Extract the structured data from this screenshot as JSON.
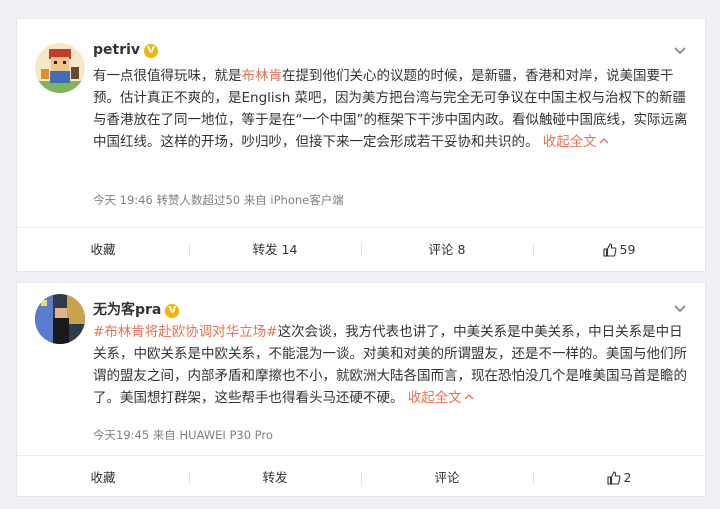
{
  "posts": [
    {
      "username": "petriv",
      "text_segments": [
        "有一点很值得玩味，就是",
        "布林肯",
        "在提到他们关心的议题的时候，是新疆，香港和对岸，说美国要干预。估计真正不爽的，是English 菜吧，因为美方把台湾与完全无可争议在中国主权与治权下的新疆与香港放在了同一地位，等于是在“一个中国”的框架下干涉中国内政。看似触碰中国底线，实际远离中国红线。这样的开场，吵归吵，但接下来一定会形成若干妥协和共识的。",
        "收起全文"
      ],
      "meta": "今天 19:46 转赞人数超过50   来自 iPhone客户端",
      "actions": {
        "collect": "收藏",
        "repost": "转发 14",
        "comment": "评论 8",
        "like": "59"
      }
    },
    {
      "username": "无为客pra",
      "text_segments": [
        "#布林肯将赴欧协调对华立场#",
        "这次会谈，我方代表也讲了，中美关系是中美关系，中日关系是中日关系，中欧关系是中欧关系，不能混为一谈。对美和对美的所谓盟友，还是不一样的。美国与他们所谓的盟友之间，内部矛盾和摩擦也不小，就欧洲大陆各国而言，现在恐怕没几个是唯美国马首是瞻的了。美国想打群架，这些帮手也得看头马还硬不硬。",
        "收起全文"
      ],
      "meta": "今天19:45 来自 HUAWEI P30 Pro",
      "actions": {
        "collect": "收藏",
        "repost": "转发",
        "comment": "评论",
        "like": "2"
      }
    }
  ],
  "icons": {
    "verified": "verified-v-icon",
    "more": "chevron-down-icon",
    "like": "thumbs-up-icon",
    "collapse": "chevron-up-icon"
  },
  "colors": {
    "accent": "#eb7350",
    "badge": "#f4b400"
  }
}
